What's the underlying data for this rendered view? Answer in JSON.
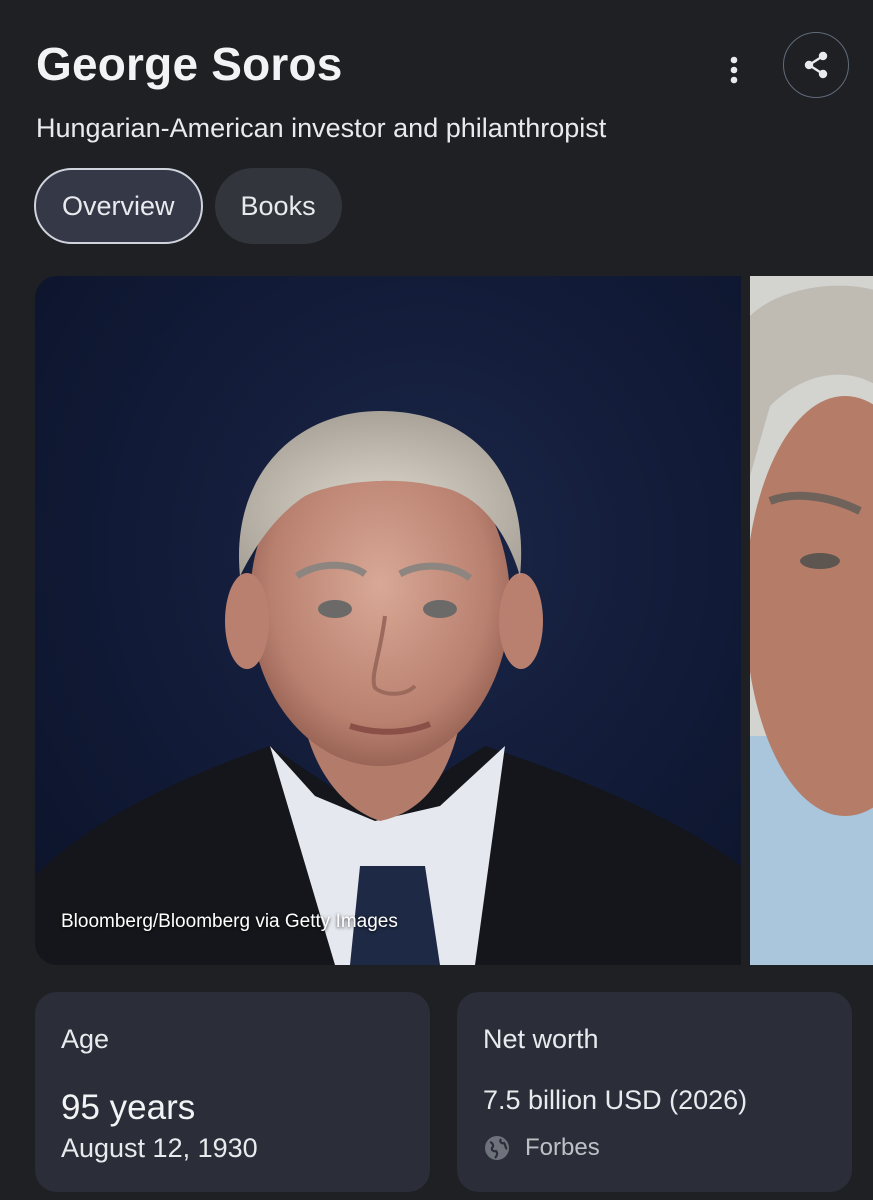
{
  "header": {
    "title": "George Soros",
    "subtitle": "Hungarian-American investor and philanthropist"
  },
  "tabs": [
    {
      "label": "Overview",
      "active": true
    },
    {
      "label": "Books",
      "active": false
    }
  ],
  "images": {
    "main_caption": "Bloomberg/Bloomberg via Getty Images"
  },
  "cards": {
    "age": {
      "label": "Age",
      "value": "95 years",
      "date": "August 12, 1930"
    },
    "net_worth": {
      "label": "Net worth",
      "value": "7.5 billion USD (2026)",
      "source": "Forbes"
    }
  },
  "icons": {
    "more": "more-vert-icon",
    "share": "share-icon",
    "source": "globe-icon"
  },
  "colors": {
    "background": "#1f2023",
    "card": "#2b2e38",
    "active_tab": "#343847"
  }
}
